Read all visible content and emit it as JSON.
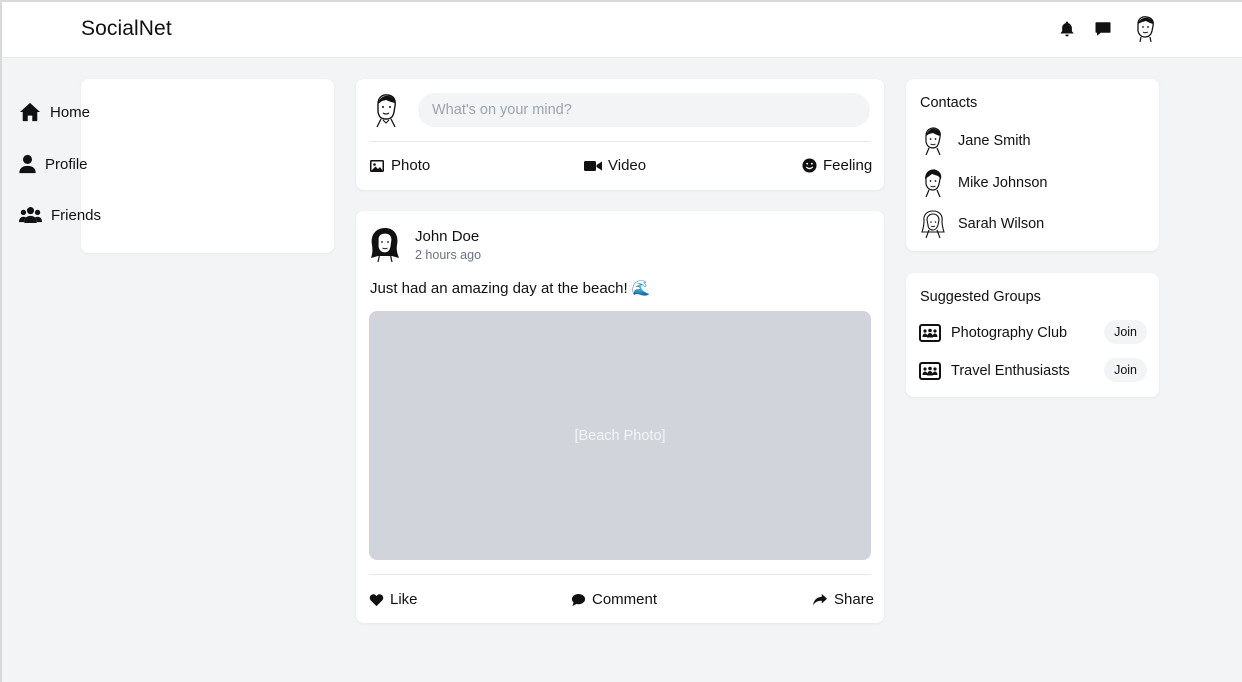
{
  "header": {
    "brand": "SocialNet",
    "icons": [
      "bell-icon",
      "chat-icon",
      "user-avatar"
    ]
  },
  "nav": {
    "items": [
      {
        "label": "Home",
        "icon": "home-icon"
      },
      {
        "label": "Profile",
        "icon": "user-icon"
      },
      {
        "label": "Friends",
        "icon": "users-icon"
      }
    ]
  },
  "composer": {
    "placeholder": "What's on your mind?",
    "actions": [
      {
        "label": "Photo",
        "icon": "image-icon"
      },
      {
        "label": "Video",
        "icon": "video-icon"
      },
      {
        "label": "Feeling",
        "icon": "smile-icon"
      }
    ]
  },
  "post": {
    "author": "John Doe",
    "time": "2 hours ago",
    "text": "Just had an amazing day at the beach! 🌊",
    "image_label": "[Beach Photo]",
    "actions": [
      {
        "label": "Like",
        "icon": "heart-icon"
      },
      {
        "label": "Comment",
        "icon": "comment-icon"
      },
      {
        "label": "Share",
        "icon": "share-icon"
      }
    ]
  },
  "contacts": {
    "title": "Contacts",
    "items": [
      {
        "name": "Jane Smith"
      },
      {
        "name": "Mike Johnson"
      },
      {
        "name": "Sarah Wilson"
      }
    ]
  },
  "groups": {
    "title": "Suggested Groups",
    "items": [
      {
        "name": "Photography Club",
        "button": "Join"
      },
      {
        "name": "Travel Enthusiasts",
        "button": "Join"
      }
    ]
  },
  "colors": {
    "background": "#f3f4f6",
    "card": "#ffffff",
    "text": "#111827",
    "muted": "#6b7280",
    "image_placeholder": "#d1d5db"
  }
}
